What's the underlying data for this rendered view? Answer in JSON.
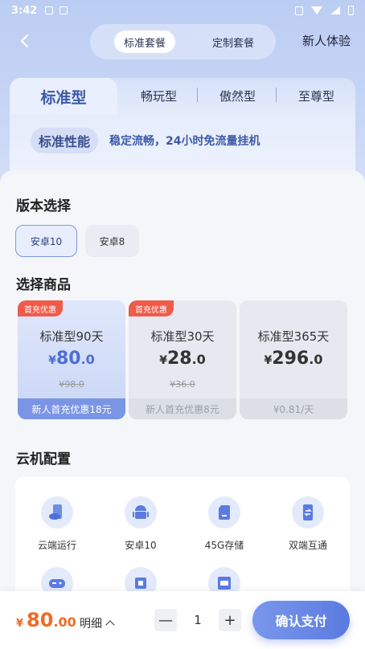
{
  "status_bar": {
    "time": "3:42"
  },
  "header": {
    "segments": [
      "标准套餐",
      "定制套餐"
    ],
    "active_segment": 0,
    "new_user_label": "新人体验"
  },
  "type_tabs": {
    "items": [
      "标准型",
      "畅玩型",
      "傲然型",
      "至尊型"
    ],
    "active": 0,
    "perf_badge": "标准性能",
    "perf_desc": "稳定流畅，24小时免流量挂机"
  },
  "version": {
    "title": "版本选择",
    "options": [
      "安卓10",
      "安卓8"
    ],
    "selected": 0
  },
  "products": {
    "title": "选择商品",
    "items": [
      {
        "tag": "首充优惠",
        "name": "标准型90天",
        "currency": "¥",
        "price_int": "80",
        "price_dec": ".0",
        "original": "¥98.0",
        "footer": "新人首充优惠18元"
      },
      {
        "tag": "首充优惠",
        "name": "标准型30天",
        "currency": "¥",
        "price_int": "28",
        "price_dec": ".0",
        "original": "¥36.0",
        "footer": "新人首充优惠8元"
      },
      {
        "tag": "",
        "name": "标准型365天",
        "currency": "¥",
        "price_int": "296",
        "price_dec": ".0",
        "original": "",
        "footer": "¥0.81/天"
      }
    ]
  },
  "config": {
    "title": "云机配置",
    "items": [
      {
        "label": "云端运行",
        "icon": "cloud-phone-icon"
      },
      {
        "label": "安卓10",
        "icon": "android-icon"
      },
      {
        "label": "45G存储",
        "icon": "sd-card-icon"
      },
      {
        "label": "双端互通",
        "icon": "sync-phone-icon"
      },
      {
        "label": "",
        "icon": "gamepad-icon"
      },
      {
        "label": "",
        "icon": "chip-icon"
      },
      {
        "label": "",
        "icon": "cpu-icon"
      }
    ]
  },
  "bottom": {
    "currency": "¥",
    "total_int": "80",
    "total_dec": ".00",
    "detail_label": "明细",
    "quantity": "1",
    "minus": "—",
    "plus": "+",
    "pay_label": "确认支付"
  },
  "colors": {
    "accent": "#5a7be0",
    "price_orange": "#ef6b26",
    "tag_red": "#ef5b4a"
  }
}
